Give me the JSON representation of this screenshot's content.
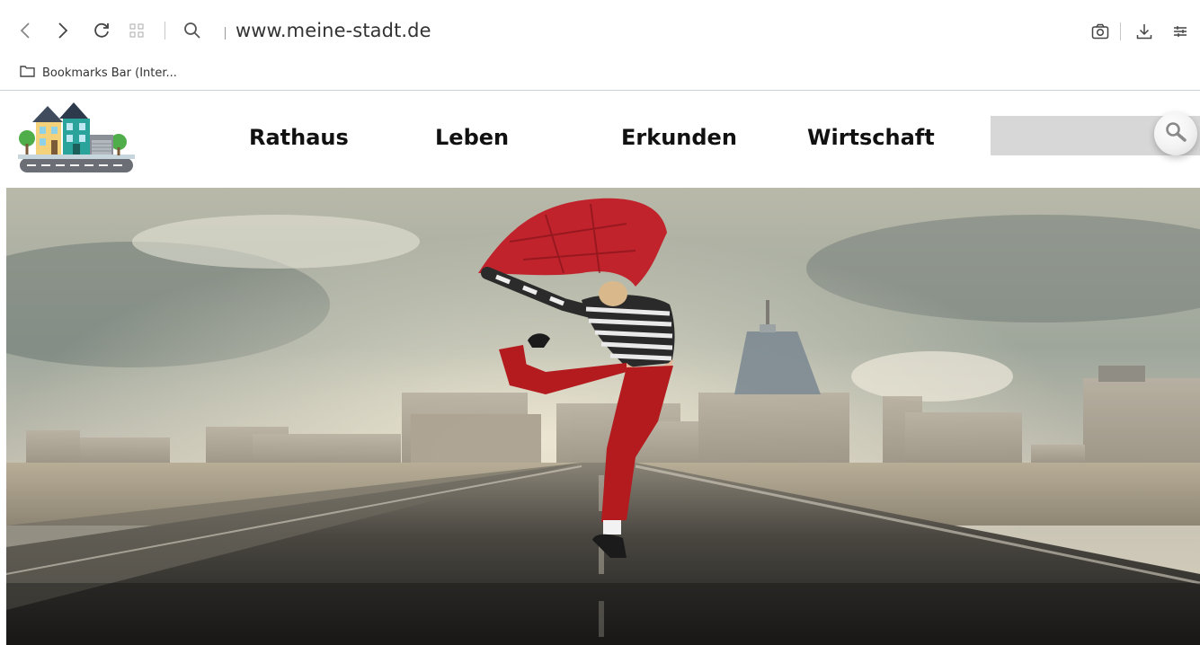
{
  "browser": {
    "url": "www.meine-stadt.de",
    "bookmarks_bar_label": "Bookmarks Bar (Inter...",
    "icons": [
      "back-icon",
      "forward-icon",
      "reload-icon",
      "tabs-grid-icon",
      "search-icon",
      "camera-icon",
      "download-icon",
      "settings-icon",
      "folder-icon"
    ]
  },
  "site": {
    "nav": {
      "items": [
        {
          "label": "Rathaus"
        },
        {
          "label": "Leben"
        },
        {
          "label": "Erkunden"
        },
        {
          "label": "Wirtschaft"
        }
      ]
    },
    "search": {
      "placeholder": "",
      "value": ""
    },
    "hero": {
      "alt": "hero-image-dancer-on-road"
    }
  },
  "colors": {
    "nav_text": "#111111",
    "search_bg": "#d7d7d7",
    "scarf_red": "#c0232c",
    "pants_red": "#b31b1e"
  }
}
